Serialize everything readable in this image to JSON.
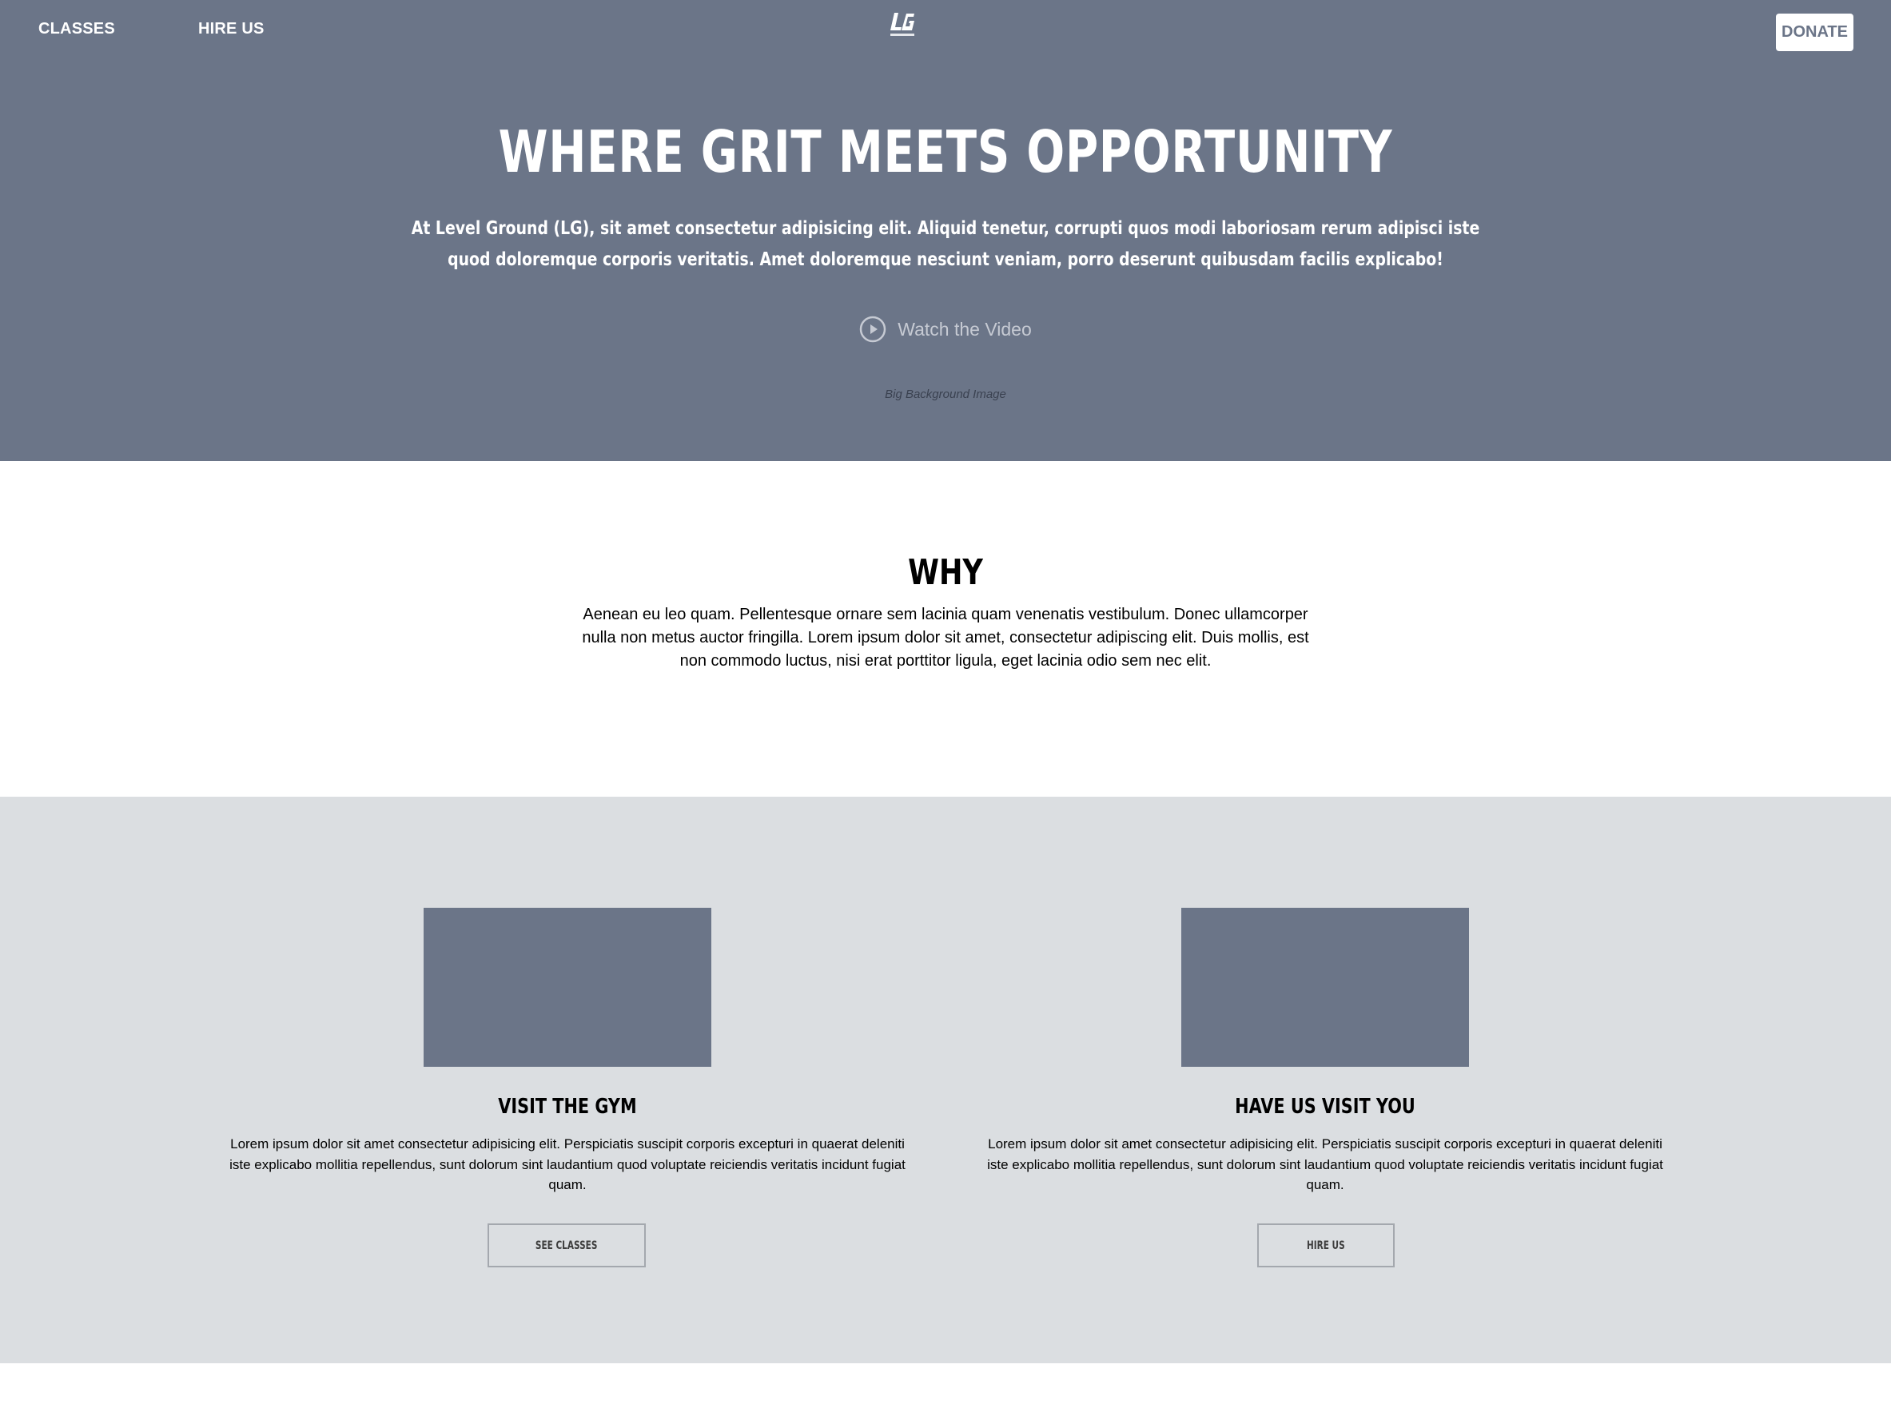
{
  "nav": {
    "classes_label": "CLASSES",
    "hire_label": "HIRE US",
    "logo_text": "LG",
    "donate_label": "DONATE"
  },
  "hero": {
    "title": "WHERE GRIT MEETS OPPORTUNITY",
    "subtitle": "At Level Ground (LG), sit amet consectetur adipisicing elit. Aliquid tenetur, corrupti quos modi laboriosam rerum adipisci iste quod doloremque corporis veritatis. Amet doloremque nesciunt veniam, porro deserunt quibusdam facilis explicabo!",
    "watch_label": "Watch the Video",
    "bg_caption": "Big Background Image"
  },
  "why": {
    "title": "WHY",
    "body": "Aenean eu leo quam. Pellentesque ornare sem lacinia quam venenatis vestibulum. Donec ullamcorper nulla non metus auctor fringilla. Lorem ipsum dolor sit amet, consectetur adipiscing elit. Duis mollis, est non commodo luctus, nisi erat porttitor ligula, eget lacinia odio sem nec elit."
  },
  "cards": [
    {
      "title": "VISIT THE GYM",
      "body": "Lorem ipsum dolor sit amet consectetur adipisicing elit. Perspiciatis suscipit corporis excepturi in quaerat deleniti iste explicabo mollitia repellendus, sunt dolorum sint laudantium quod voluptate reiciendis veritatis incidunt fugiat quam.",
      "button_label": "SEE CLASSES"
    },
    {
      "title": "HAVE US VISIT YOU",
      "body": "Lorem ipsum dolor sit amet consectetur adipisicing elit. Perspiciatis suscipit corporis excepturi in quaerat deleniti iste explicabo mollitia repellendus, sunt dolorum sint laudantium quod voluptate reiciendis veritatis incidunt fugiat quam.",
      "button_label": "HIRE US"
    }
  ],
  "colors": {
    "hero_bg": "#6b7588",
    "cards_bg": "#dbdee1",
    "placeholder_img": "#6b7588",
    "watch_text": "#c6cad3"
  },
  "icons": {
    "logo": "lg-logo-icon",
    "play": "play-circle-icon"
  }
}
